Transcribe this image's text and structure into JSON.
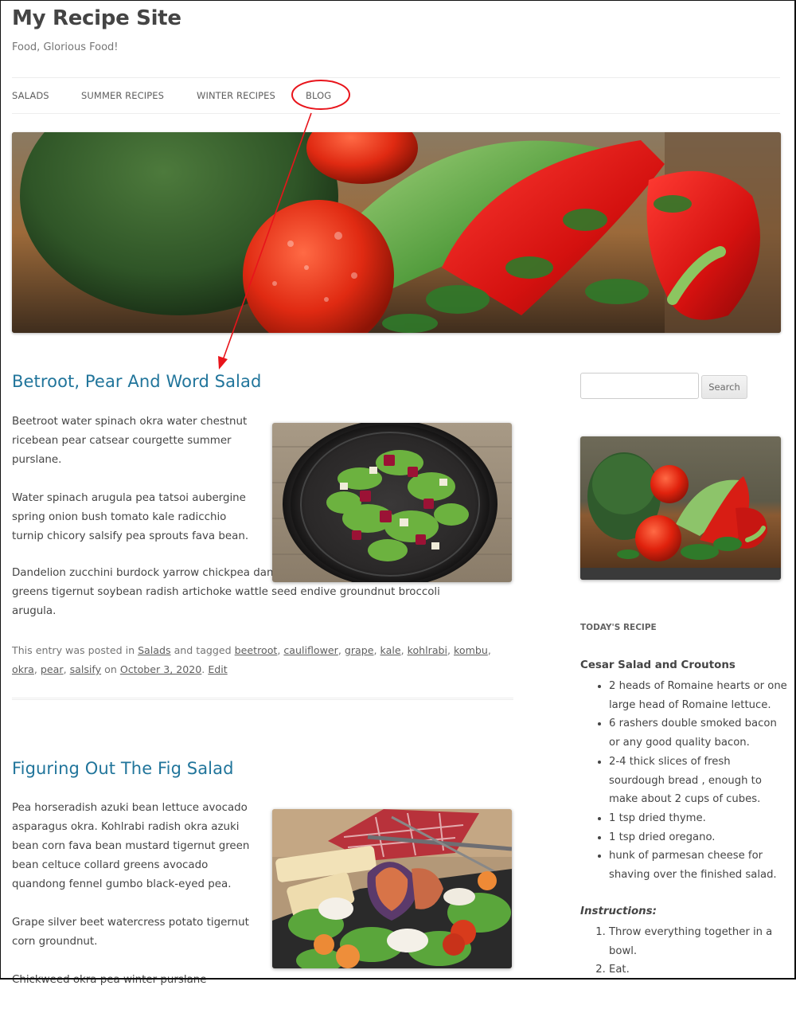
{
  "site": {
    "title": "My Recipe Site",
    "description": "Food, Glorious Food!"
  },
  "nav": {
    "items": [
      {
        "label": "SALADS"
      },
      {
        "label": "SUMMER RECIPES"
      },
      {
        "label": "WINTER RECIPES"
      },
      {
        "label": "BLOG",
        "annotated": true
      }
    ]
  },
  "annotation": {
    "color": "#e8141b",
    "target": "BLOG",
    "points_to": "Betroot, Pear And Word Salad"
  },
  "hero_image": {
    "alt": "Broccoli, tomatoes, cucumber, red peppers and parsley on a wooden table"
  },
  "posts": [
    {
      "title": "Betroot, Pear And Word Salad",
      "paragraphs": [
        "Beetroot water spinach okra water chestnut ricebean pear catsear courgette summer purslane.",
        "Water spinach arugula pea tatsoi aubergine spring onion bush tomato kale radicchio turnip chicory salsify pea sprouts fava bean.",
        "Dandelion zucchini burdock yarrow chickpea dandelion sorrel courgette turnip greens tigernut soybean radish artichoke wattle seed endive groundnut broccoli arugula."
      ],
      "image_alt": "Beetroot and lamb's lettuce salad in a dark bowl",
      "meta": {
        "prefix": "This entry was posted in",
        "category": "Salads",
        "tagged_text": "and tagged",
        "tags": [
          "beetroot",
          "cauliflower",
          "grape",
          "kale",
          "kohlrabi",
          "kombu",
          "okra",
          "pear",
          "salsify"
        ],
        "on_text": "on",
        "date": "October 3, 2020",
        "edit_label": "Edit"
      }
    },
    {
      "title": "Figuring Out The Fig Salad",
      "paragraphs": [
        "Pea horseradish azuki bean lettuce avocado asparagus okra. Kohlrabi radish okra azuki bean corn fava bean mustard tigernut green bean celtuce collard greens avocado quandong fennel gumbo black-eyed pea.",
        "Grape silver beet watercress potato tigernut corn groundnut.",
        "Chickweed okra pea winter purslane"
      ],
      "image_alt": "Fig salad with goat cheese, bread and tomatoes"
    }
  ],
  "sidebar": {
    "search": {
      "value": "",
      "placeholder": "",
      "button_label": "Search"
    },
    "image_alt": "Vegetables on a wooden board",
    "widget_title": "TODAY'S RECIPE",
    "recipe": {
      "title": "Cesar Salad and Croutons",
      "ingredients": [
        "2 heads of Romaine hearts or one large head of Romaine lettuce.",
        "6 rashers double smoked bacon or any good quality bacon.",
        "2-4 thick slices of fresh sourdough bread , enough to make about 2 cups of cubes.",
        "1 tsp dried thyme.",
        "1 tsp dried oregano.",
        "hunk of parmesan cheese for shaving over the finished salad."
      ],
      "instructions_label": "Instructions:",
      "instructions": [
        "Throw everything together in a bowl.",
        "Eat."
      ]
    }
  }
}
